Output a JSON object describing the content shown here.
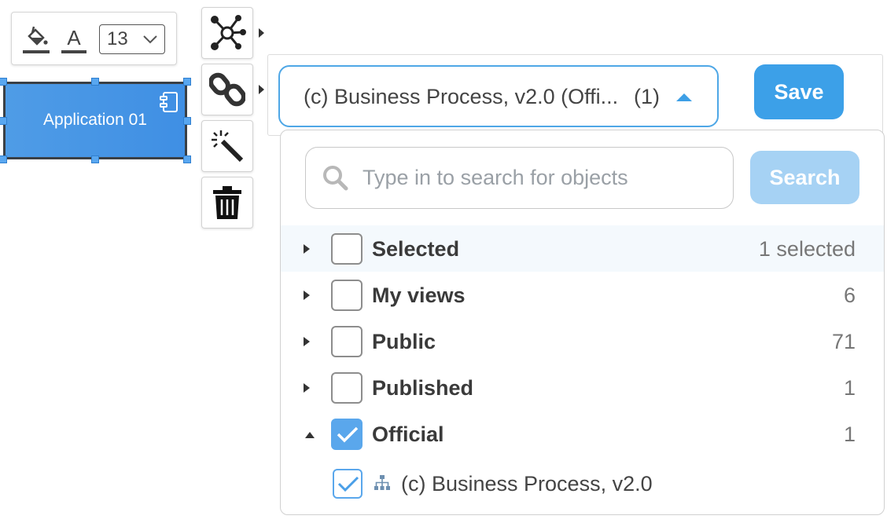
{
  "format_toolbar": {
    "fill_icon": "paint-bucket-icon",
    "text_color_icon": "text-color-icon",
    "text_color_glyph": "A",
    "font_size": "13"
  },
  "node": {
    "label": "Application 01",
    "icon": "application-component-icon",
    "fill_color": "#4a98e5",
    "border_color": "#3a4046"
  },
  "side_actions": [
    {
      "name": "relations-graph",
      "icon": "graph-nodes-icon"
    },
    {
      "name": "link",
      "icon": "chain-link-icon"
    },
    {
      "name": "magic",
      "icon": "magic-wand-icon"
    },
    {
      "name": "delete",
      "icon": "trash-icon"
    }
  ],
  "view_picker": {
    "selected_text": "(c) Business Process, v2.0 (Offi...",
    "selected_count": "(1)",
    "save_label": "Save"
  },
  "dropdown": {
    "search_placeholder": "Type in to search for objects",
    "search_value": "",
    "search_label": "Search",
    "groups": [
      {
        "label": "Selected",
        "count": "1 selected",
        "checked": false,
        "expanded": false
      },
      {
        "label": "My views",
        "count": "6",
        "checked": false,
        "expanded": false
      },
      {
        "label": "Public",
        "count": "71",
        "checked": false,
        "expanded": false
      },
      {
        "label": "Published",
        "count": "1",
        "checked": false,
        "expanded": false
      },
      {
        "label": "Official",
        "count": "1",
        "checked": true,
        "expanded": true
      }
    ],
    "items": [
      {
        "label": "(c) Business Process, v2.0",
        "icon": "hierarchy-icon",
        "checked": true
      }
    ]
  },
  "colors": {
    "accent": "#3ca0e8",
    "search_disabled": "#a6d2f4",
    "checkbox_on": "#5aa7ec",
    "highlight_row": "#f4f9fd"
  }
}
